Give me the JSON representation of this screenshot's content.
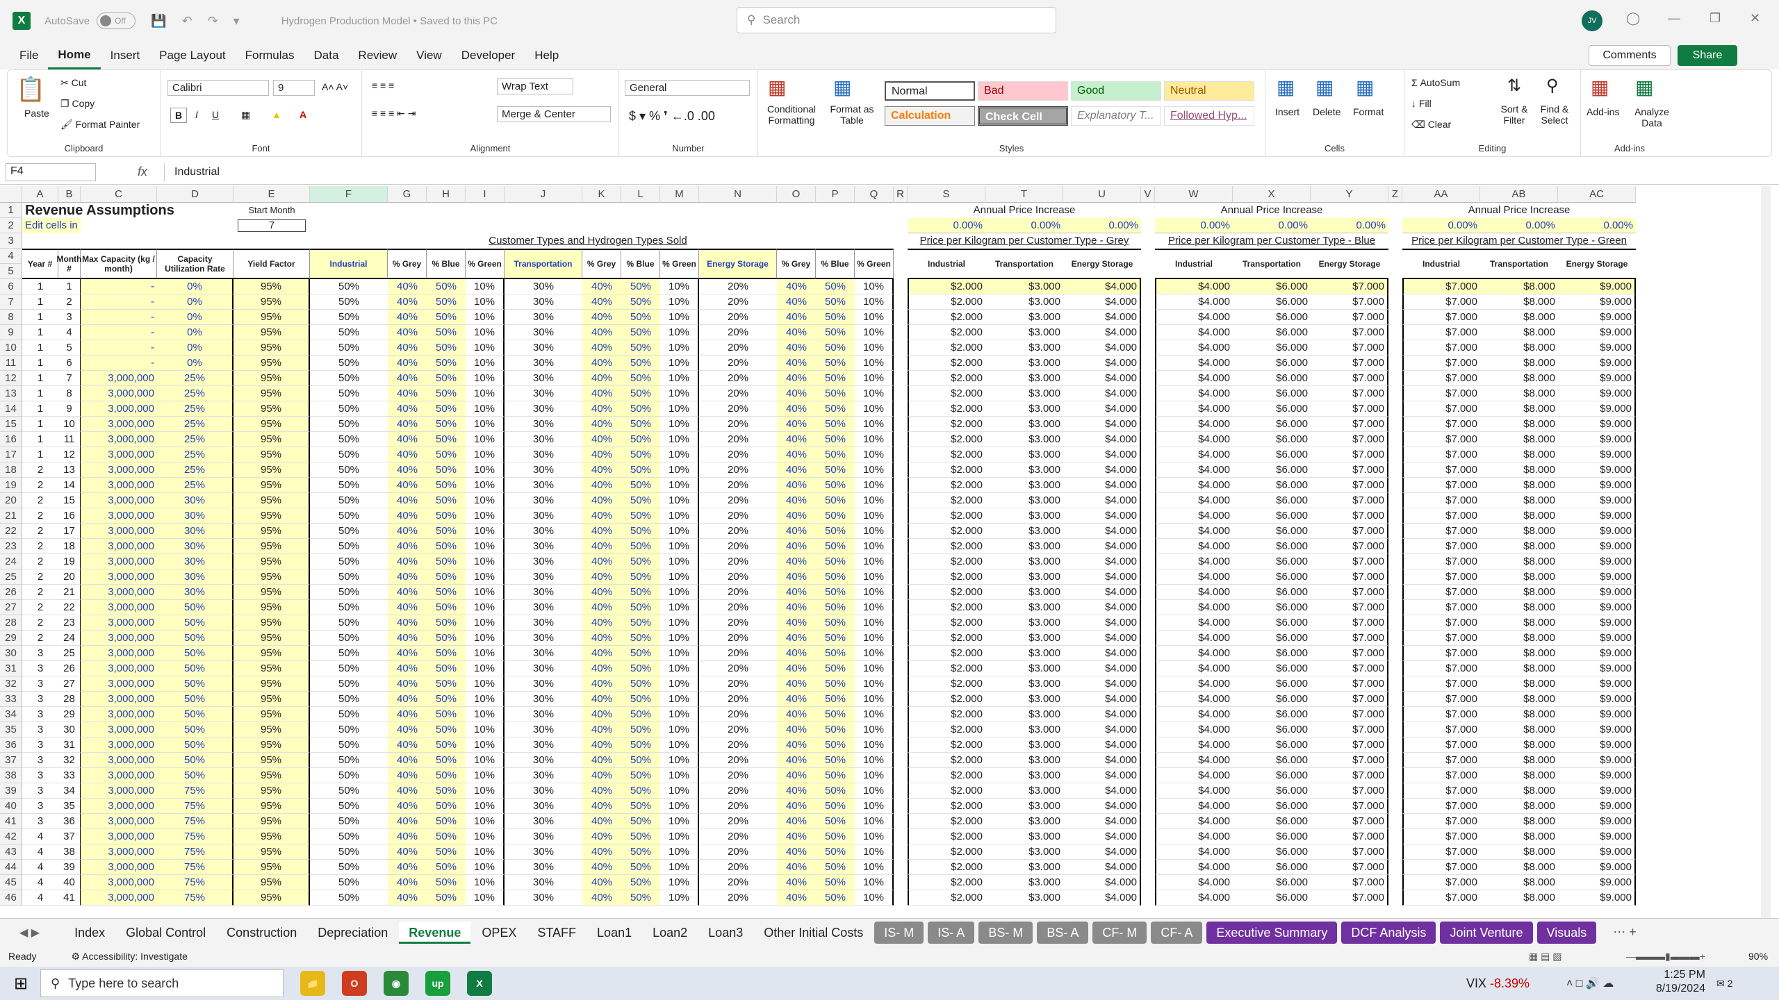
{
  "titlebar": {
    "autosave": "AutoSave",
    "autosave_state": "Off",
    "doc_title": "Hydrogen Production Model • Saved to this PC",
    "search_placeholder": "Search",
    "avatar": "JV"
  },
  "menu": [
    "File",
    "Home",
    "Insert",
    "Page Layout",
    "Formulas",
    "Data",
    "Review",
    "View",
    "Developer",
    "Help"
  ],
  "menu_active": "Home",
  "buttons": {
    "comments": "Comments",
    "share": "Share"
  },
  "ribbon": {
    "clipboard": {
      "label": "Clipboard",
      "paste": "Paste",
      "cut": "Cut",
      "copy": "Copy",
      "format_painter": "Format Painter"
    },
    "font": {
      "label": "Font",
      "name": "Calibri",
      "size": "9"
    },
    "alignment": {
      "label": "Alignment",
      "wrap": "Wrap Text",
      "merge": "Merge & Center"
    },
    "number": {
      "label": "Number",
      "format": "General"
    },
    "styles": {
      "label": "Styles",
      "conditional": "Conditional Formatting",
      "format_table": "Format as Table",
      "normal": "Normal",
      "bad": "Bad",
      "good": "Good",
      "neutral": "Neutral",
      "calculation": "Calculation",
      "check": "Check Cell",
      "explanatory": "Explanatory T...",
      "followed": "Followed Hyp..."
    },
    "cells": {
      "label": "Cells",
      "insert": "Insert",
      "delete": "Delete",
      "format": "Format"
    },
    "editing": {
      "label": "Editing",
      "autosum": "AutoSum",
      "fill": "Fill",
      "clear": "Clear",
      "sort": "Sort & Filter",
      "find": "Find & Select"
    },
    "addins": {
      "label": "Add-ins",
      "addins": "Add-ins",
      "analyze": "Analyze Data"
    }
  },
  "formula_bar": {
    "namebox": "F4",
    "formula": "Industrial"
  },
  "columns": [
    "A",
    "B",
    "C",
    "D",
    "E",
    "F",
    "G",
    "H",
    "I",
    "J",
    "K",
    "L",
    "M",
    "N",
    "O",
    "P",
    "Q",
    "R",
    "S",
    "T",
    "U",
    "V",
    "W",
    "X",
    "Y",
    "Z",
    "AA",
    "AB",
    "AC"
  ],
  "sheet": {
    "title": "Revenue Assumptions",
    "edit_note": "Edit cells in this shade only.",
    "start_month_label": "Start Month",
    "start_month": "7",
    "customer_types_title": "Customer Types and Hydrogen Types Sold",
    "api_label": "Annual Price Increase",
    "api_values": [
      "0.00%",
      "0.00%",
      "0.00%"
    ],
    "grey_title": "Price per Kilogram per Customer Type - Grey",
    "blue_title": "Price per Kilogram per Customer Type - Blue",
    "green_title": "Price per Kilogram per Customer Type - Green",
    "headers": [
      "Year #",
      "Month #",
      "Max Capacity (kg / month)",
      "Capacity Utilization Rate",
      "Yield Factor",
      "Industrial",
      "% Grey",
      "% Blue",
      "% Green",
      "Transportation",
      "% Grey",
      "% Blue",
      "% Green",
      "Energy Storage",
      "% Grey",
      "% Blue",
      "% Green"
    ],
    "price_headers": [
      "Industrial",
      "Transportation",
      "Energy Storage"
    ],
    "grey_prices": [
      "$2.000",
      "$3.000",
      "$4.000"
    ],
    "blue_prices": [
      "$4.000",
      "$6.000",
      "$7.000"
    ],
    "green_prices": [
      "$7.000",
      "$8.000",
      "$9.000"
    ],
    "rows": [
      {
        "y": "1",
        "m": "1",
        "cap": "-",
        "util": "0%"
      },
      {
        "y": "1",
        "m": "2",
        "cap": "-",
        "util": "0%"
      },
      {
        "y": "1",
        "m": "3",
        "cap": "-",
        "util": "0%"
      },
      {
        "y": "1",
        "m": "4",
        "cap": "-",
        "util": "0%"
      },
      {
        "y": "1",
        "m": "5",
        "cap": "-",
        "util": "0%"
      },
      {
        "y": "1",
        "m": "6",
        "cap": "-",
        "util": "0%"
      },
      {
        "y": "1",
        "m": "7",
        "cap": "3,000,000",
        "util": "25%"
      },
      {
        "y": "1",
        "m": "8",
        "cap": "3,000,000",
        "util": "25%"
      },
      {
        "y": "1",
        "m": "9",
        "cap": "3,000,000",
        "util": "25%"
      },
      {
        "y": "1",
        "m": "10",
        "cap": "3,000,000",
        "util": "25%"
      },
      {
        "y": "1",
        "m": "11",
        "cap": "3,000,000",
        "util": "25%"
      },
      {
        "y": "1",
        "m": "12",
        "cap": "3,000,000",
        "util": "25%"
      },
      {
        "y": "2",
        "m": "13",
        "cap": "3,000,000",
        "util": "25%"
      },
      {
        "y": "2",
        "m": "14",
        "cap": "3,000,000",
        "util": "25%"
      },
      {
        "y": "2",
        "m": "15",
        "cap": "3,000,000",
        "util": "30%"
      },
      {
        "y": "2",
        "m": "16",
        "cap": "3,000,000",
        "util": "30%"
      },
      {
        "y": "2",
        "m": "17",
        "cap": "3,000,000",
        "util": "30%"
      },
      {
        "y": "2",
        "m": "18",
        "cap": "3,000,000",
        "util": "30%"
      },
      {
        "y": "2",
        "m": "19",
        "cap": "3,000,000",
        "util": "30%"
      },
      {
        "y": "2",
        "m": "20",
        "cap": "3,000,000",
        "util": "30%"
      },
      {
        "y": "2",
        "m": "21",
        "cap": "3,000,000",
        "util": "30%"
      },
      {
        "y": "2",
        "m": "22",
        "cap": "3,000,000",
        "util": "50%"
      },
      {
        "y": "2",
        "m": "23",
        "cap": "3,000,000",
        "util": "50%"
      },
      {
        "y": "2",
        "m": "24",
        "cap": "3,000,000",
        "util": "50%"
      },
      {
        "y": "3",
        "m": "25",
        "cap": "3,000,000",
        "util": "50%"
      },
      {
        "y": "3",
        "m": "26",
        "cap": "3,000,000",
        "util": "50%"
      },
      {
        "y": "3",
        "m": "27",
        "cap": "3,000,000",
        "util": "50%"
      },
      {
        "y": "3",
        "m": "28",
        "cap": "3,000,000",
        "util": "50%"
      },
      {
        "y": "3",
        "m": "29",
        "cap": "3,000,000",
        "util": "50%"
      },
      {
        "y": "3",
        "m": "30",
        "cap": "3,000,000",
        "util": "50%"
      },
      {
        "y": "3",
        "m": "31",
        "cap": "3,000,000",
        "util": "50%"
      },
      {
        "y": "3",
        "m": "32",
        "cap": "3,000,000",
        "util": "50%"
      },
      {
        "y": "3",
        "m": "33",
        "cap": "3,000,000",
        "util": "50%"
      },
      {
        "y": "3",
        "m": "34",
        "cap": "3,000,000",
        "util": "75%"
      },
      {
        "y": "3",
        "m": "35",
        "cap": "3,000,000",
        "util": "75%"
      },
      {
        "y": "3",
        "m": "36",
        "cap": "3,000,000",
        "util": "75%"
      },
      {
        "y": "4",
        "m": "37",
        "cap": "3,000,000",
        "util": "75%"
      },
      {
        "y": "4",
        "m": "38",
        "cap": "3,000,000",
        "util": "75%"
      },
      {
        "y": "4",
        "m": "39",
        "cap": "3,000,000",
        "util": "75%"
      },
      {
        "y": "4",
        "m": "40",
        "cap": "3,000,000",
        "util": "75%"
      },
      {
        "y": "4",
        "m": "41",
        "cap": "3,000,000",
        "util": "75%"
      }
    ],
    "const": {
      "yield": "95%",
      "ind": "50%",
      "trans": "30%",
      "energy": "20%",
      "grey": "40%",
      "blue": "50%",
      "green": "10%"
    }
  },
  "tabs": [
    {
      "label": "Index",
      "style": "plain"
    },
    {
      "label": "Global Control",
      "style": "plain"
    },
    {
      "label": "Construction",
      "style": "plain"
    },
    {
      "label": "Depreciation",
      "style": "plain"
    },
    {
      "label": "Revenue",
      "style": "active"
    },
    {
      "label": "OPEX",
      "style": "plain"
    },
    {
      "label": "STAFF",
      "style": "plain"
    },
    {
      "label": "Loan1",
      "style": "plain"
    },
    {
      "label": "Loan2",
      "style": "plain"
    },
    {
      "label": "Loan3",
      "style": "plain"
    },
    {
      "label": "Other Initial Costs",
      "style": "plain"
    },
    {
      "label": "IS- M",
      "style": "gray"
    },
    {
      "label": "IS- A",
      "style": "gray"
    },
    {
      "label": "BS- M",
      "style": "gray"
    },
    {
      "label": "BS- A",
      "style": "gray"
    },
    {
      "label": "CF- M",
      "style": "gray"
    },
    {
      "label": "CF- A",
      "style": "gray"
    },
    {
      "label": "Executive Summary",
      "style": "purple"
    },
    {
      "label": "DCF Analysis",
      "style": "purple"
    },
    {
      "label": "Joint Venture",
      "style": "purple"
    },
    {
      "label": "Visuals",
      "style": "purple"
    }
  ],
  "status": {
    "ready": "Ready",
    "accessibility": "Accessibility: Investigate",
    "zoom": "90%"
  },
  "taskbar": {
    "search": "Type here to search",
    "vix_label": "VIX",
    "vix_value": "-8.39%",
    "time": "1:25 PM",
    "date": "8/19/2024",
    "notif_count": "2"
  }
}
